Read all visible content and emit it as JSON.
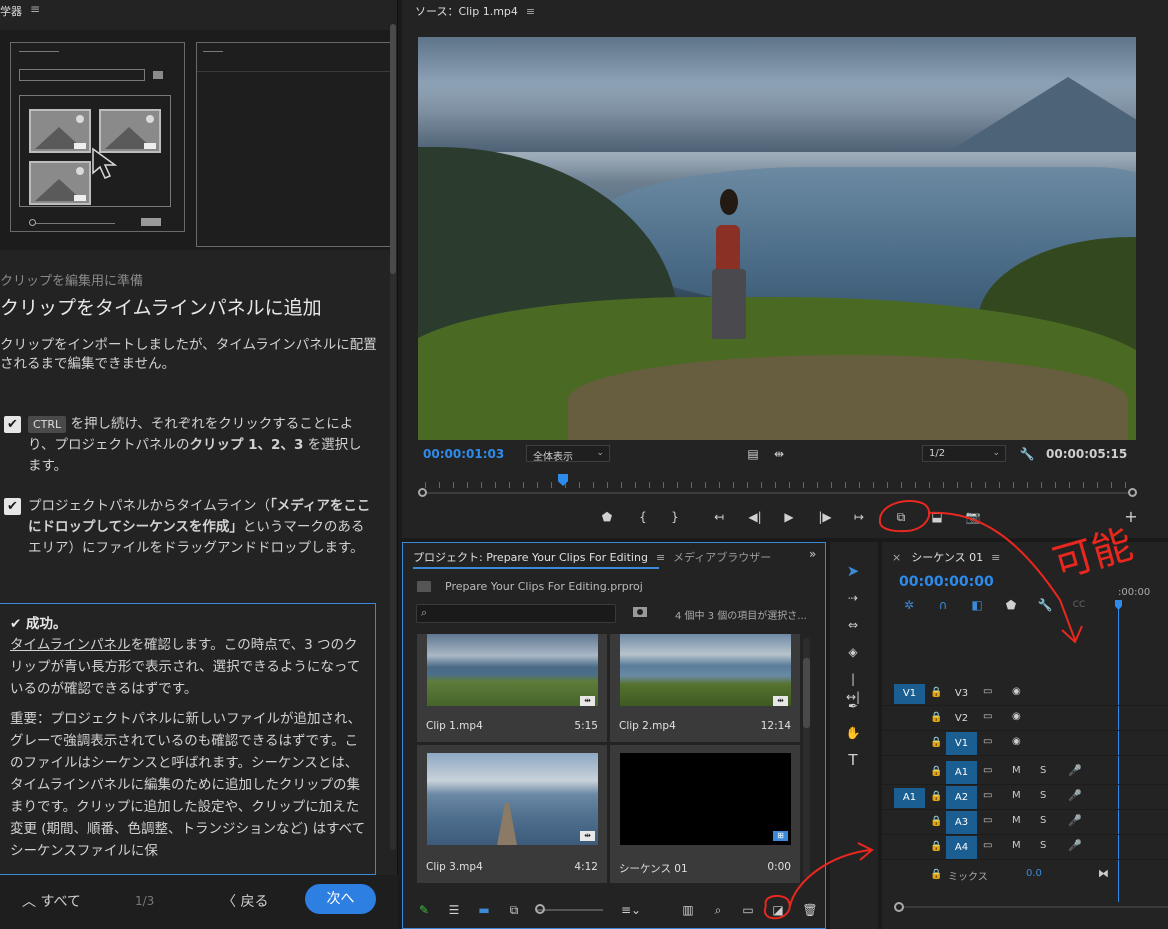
{
  "learn": {
    "title": "学器",
    "menu_icon": "≡",
    "subtitle": "クリップを編集用に準備",
    "heading": "クリップをタイムラインパネルに追加",
    "intro": "クリップをインポートしましたが、タイムラインパネルに配置されるまで編集できません。",
    "step1": {
      "key": "CTRL",
      "text_a": " を押し続け、それぞれをクリックすることにより、プロジェクトパネルの",
      "bold": "クリップ 1、2、3",
      "text_b": " を選択します。"
    },
    "step2": {
      "text_a": "プロジェクトパネルからタイムライン（",
      "bold": "「メディアをここにドロップしてシーケンスを作成」",
      "text_b": "というマークのあるエリア）にファイルをドラッグアンドドロップします。"
    },
    "success": {
      "title": "成功。",
      "link": "タイムラインパネル",
      "p1": "を確認します。この時点で、3 つのクリップが青い長方形で表示され、選択できるようになっているのが確認できるはずです。",
      "p2": "重要：プロジェクトパネルに新しいファイルが追加され、グレーで強調表示されているのも確認できるはずです。このファイルはシーケンスと呼ばれます。シーケンスとは、タイムラインパネルに編集のために追加したクリップの集まりです。クリップに追加した設定や、クリップに加えた変更 (期間、順番、色調整、トランジションなど) はすべてシーケンスファイルに保"
    },
    "footer": {
      "all": "すべて",
      "page": "1/3",
      "back": "戻る",
      "next": "次へ"
    }
  },
  "source": {
    "title": "ソース：Clip 1.mp4",
    "menu_icon": "≡",
    "timecode_in": "00:00:01:03",
    "zoom": "全体表示",
    "resolution": "1/2",
    "duration": "00:00:05:15"
  },
  "project": {
    "tab_project": "プロジェクト: Prepare Your Clips For Editing",
    "tab_media": "メディアブラウザー",
    "menu_icon": "≡",
    "more": "»",
    "file": "Prepare Your Clips For Editing.prproj",
    "search_icon": "⌕",
    "count": "4 個中 3 個の項目が選択さ...",
    "items": [
      {
        "name": "Clip 1.mp4",
        "duration": "5:15"
      },
      {
        "name": "Clip 2.mp4",
        "duration": "12:14"
      },
      {
        "name": "Clip 3.mp4",
        "duration": "4:12"
      },
      {
        "name": "シーケンス 01",
        "duration": "0:00"
      }
    ]
  },
  "timeline": {
    "close": "×",
    "title": "シーケンス 01",
    "menu_icon": "≡",
    "timecode": "00:00:00:00",
    "ruler_tc": ":00:00",
    "tracks": [
      {
        "src": "V1",
        "target": "V3",
        "on": false,
        "c1": "▭",
        "c2": "◉",
        "c3": "",
        "c4": ""
      },
      {
        "src": "",
        "target": "V2",
        "on": false,
        "c1": "▭",
        "c2": "◉",
        "c3": "",
        "c4": ""
      },
      {
        "src": "",
        "target": "V1",
        "on": true,
        "c1": "▭",
        "c2": "◉",
        "c3": "",
        "c4": ""
      },
      {
        "src": "",
        "target": "A1",
        "on": true,
        "c1": "▭",
        "c2": "M",
        "c3": "S",
        "c4": "🎤"
      },
      {
        "src": "A1",
        "target": "A2",
        "on": true,
        "c1": "▭",
        "c2": "M",
        "c3": "S",
        "c4": "🎤"
      },
      {
        "src": "",
        "target": "A3",
        "on": true,
        "c1": "▭",
        "c2": "M",
        "c3": "S",
        "c4": "🎤"
      },
      {
        "src": "",
        "target": "A4",
        "on": true,
        "c1": "▭",
        "c2": "M",
        "c3": "S",
        "c4": "🎤"
      }
    ],
    "mix_label": "ミックス",
    "mix_value": "0.0"
  },
  "annotation": {
    "text": "可能",
    "color": "#e8281e"
  }
}
